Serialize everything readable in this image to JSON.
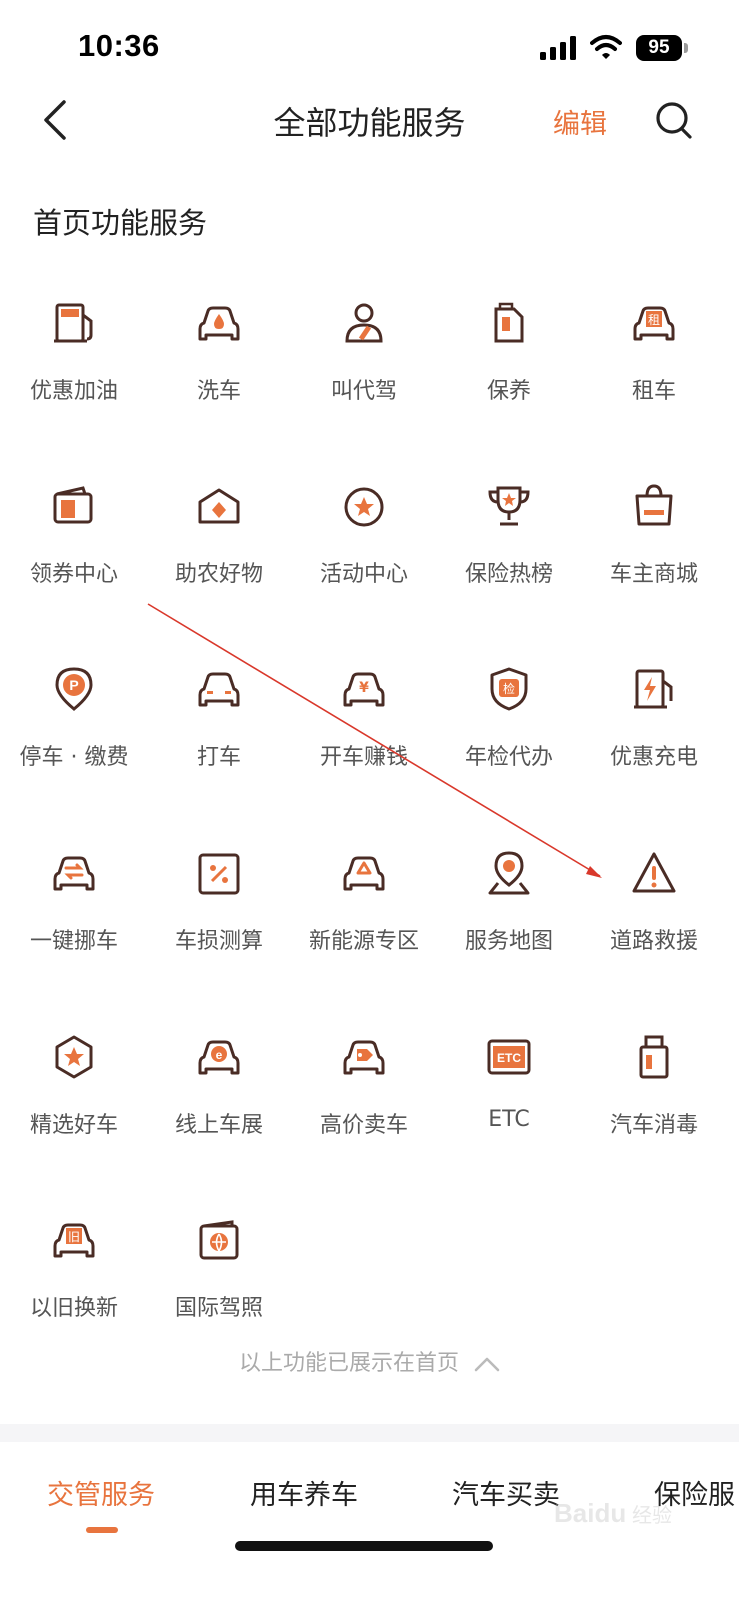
{
  "status_bar": {
    "time": "10:36",
    "battery": "95"
  },
  "nav": {
    "title": "全部功能服务",
    "edit_label": "编辑"
  },
  "section_title": "首页功能服务",
  "services": [
    {
      "label": "优惠加油",
      "icon": "fuel-pump-icon"
    },
    {
      "label": "洗车",
      "icon": "car-wash-icon"
    },
    {
      "label": "叫代驾",
      "icon": "designated-driver-icon"
    },
    {
      "label": "保养",
      "icon": "oil-can-icon"
    },
    {
      "label": "租车",
      "icon": "car-rental-icon"
    },
    {
      "label": "领券中心",
      "icon": "coupon-wallet-icon"
    },
    {
      "label": "助农好物",
      "icon": "farm-goods-icon"
    },
    {
      "label": "活动中心",
      "icon": "star-badge-icon"
    },
    {
      "label": "保险热榜",
      "icon": "trophy-icon"
    },
    {
      "label": "车主商城",
      "icon": "shopping-bag-icon"
    },
    {
      "label": "停车 · 缴费",
      "icon": "parking-pin-icon"
    },
    {
      "label": "打车",
      "icon": "taxi-icon"
    },
    {
      "label": "开车赚钱",
      "icon": "earn-money-car-icon"
    },
    {
      "label": "年检代办",
      "icon": "inspection-shield-icon"
    },
    {
      "label": "优惠充电",
      "icon": "ev-charger-icon"
    },
    {
      "label": "一键挪车",
      "icon": "move-car-icon"
    },
    {
      "label": "车损测算",
      "icon": "damage-estimate-icon"
    },
    {
      "label": "新能源专区",
      "icon": "new-energy-car-icon"
    },
    {
      "label": "服务地图",
      "icon": "map-pin-icon"
    },
    {
      "label": "道路救援",
      "icon": "warning-triangle-icon"
    },
    {
      "label": "精选好车",
      "icon": "featured-car-icon"
    },
    {
      "label": "线上车展",
      "icon": "online-auto-show-icon"
    },
    {
      "label": "高价卖车",
      "icon": "sell-car-tag-icon"
    },
    {
      "label": "ETC",
      "icon": "etc-card-icon",
      "badge": "ETC"
    },
    {
      "label": "汽车消毒",
      "icon": "disinfectant-bottle-icon"
    },
    {
      "label": "以旧换新",
      "icon": "trade-in-car-icon",
      "badge": "旧"
    },
    {
      "label": "国际驾照",
      "icon": "international-license-icon"
    }
  ],
  "collapse_text": "以上功能已展示在首页",
  "tabs": [
    {
      "label": "交管服务",
      "active": true
    },
    {
      "label": "用车养车",
      "active": false
    },
    {
      "label": "汽车买卖",
      "active": false
    },
    {
      "label": "保险服",
      "active": false
    }
  ],
  "watermark_text": "Baidu 经验",
  "colors": {
    "accent": "#e8743e",
    "icon_stroke": "#4a2c25",
    "icon_fill": "#e8743e",
    "annotation": "#d9382b"
  }
}
